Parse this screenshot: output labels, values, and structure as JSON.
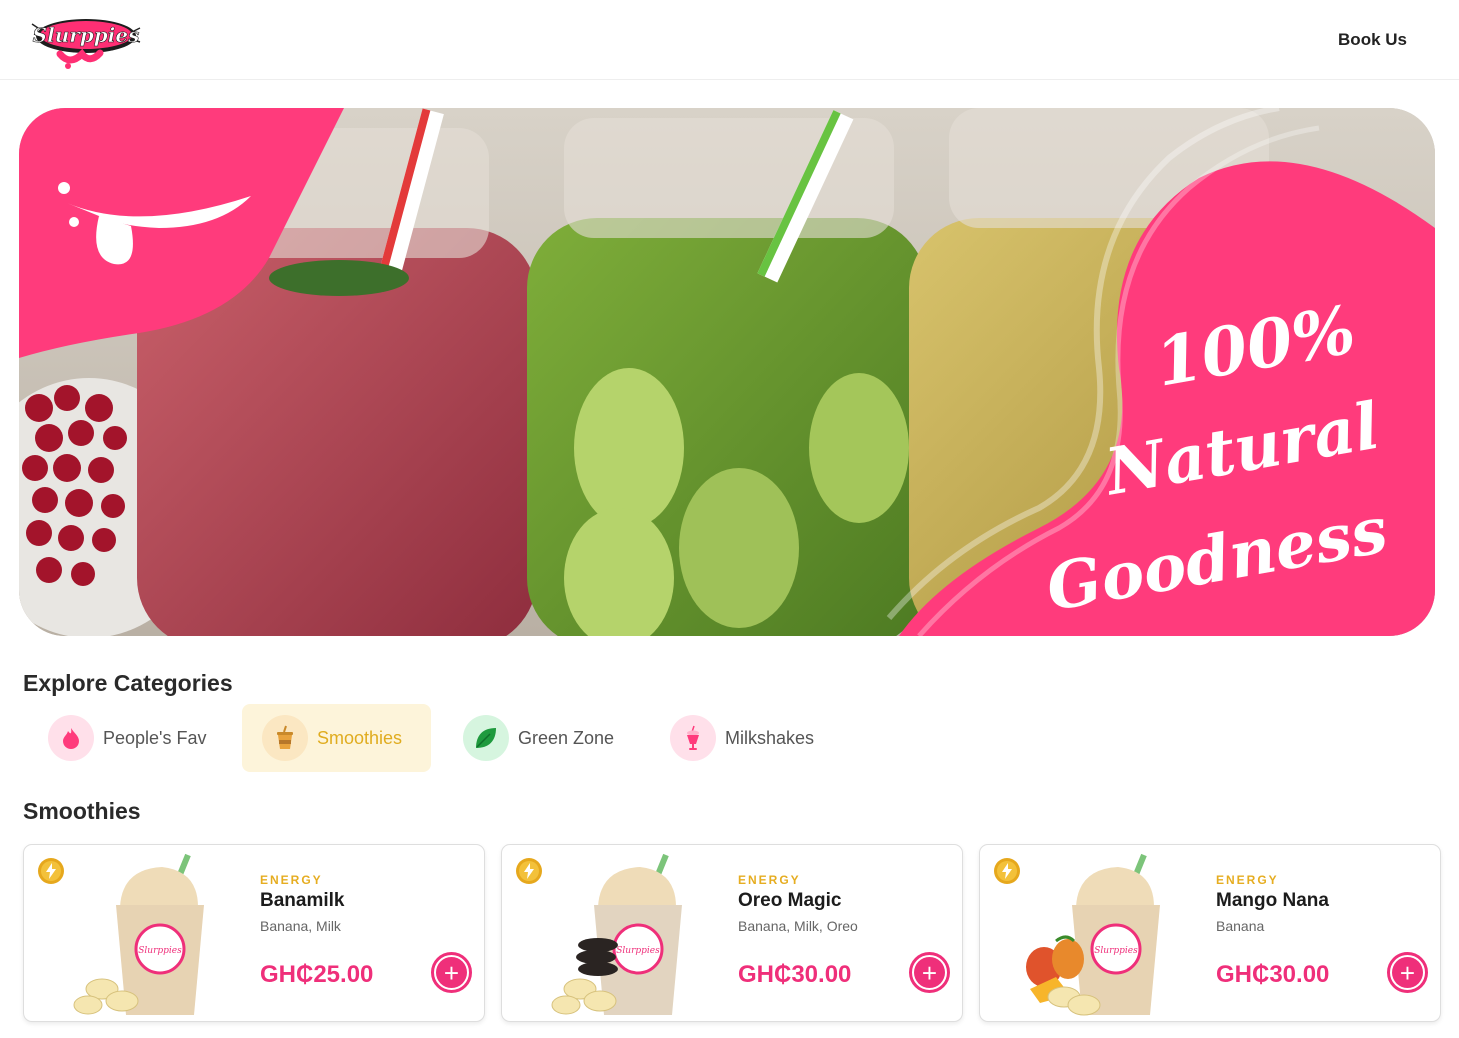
{
  "header": {
    "logo_text": "Slurppies",
    "book_us_label": "Book Us"
  },
  "hero": {
    "line1": "100%",
    "line2": "Natural",
    "line3": "Goodness",
    "accent_color": "#ff3b7c"
  },
  "categories_section": {
    "title": "Explore Categories",
    "items": [
      {
        "label": "People's Fav",
        "icon": "flame-icon",
        "active": false
      },
      {
        "label": "Smoothies",
        "icon": "cup-icon",
        "active": true
      },
      {
        "label": "Green Zone",
        "icon": "leaf-icon",
        "active": false
      },
      {
        "label": "Milkshakes",
        "icon": "milkshake-icon",
        "active": false
      }
    ]
  },
  "products_section": {
    "title": "Smoothies",
    "items": [
      {
        "tag": "ENERGY",
        "name": "Banamilk",
        "ingredients": "Banana, Milk",
        "price": "GH₵25.00",
        "badge_icon": "bolt-icon",
        "garnish": "banana"
      },
      {
        "tag": "ENERGY",
        "name": "Oreo Magic",
        "ingredients": "Banana, Milk, Oreo",
        "price": "GH₵30.00",
        "badge_icon": "bolt-icon",
        "garnish": "oreo"
      },
      {
        "tag": "ENERGY",
        "name": "Mango Nana",
        "ingredients": "Banana",
        "price": "GH₵30.00",
        "badge_icon": "bolt-icon",
        "garnish": "mango"
      }
    ]
  },
  "colors": {
    "brand_pink": "#ef2f7a",
    "energy_gold": "#e6ad21",
    "active_category_bg": "#fdf4da"
  }
}
